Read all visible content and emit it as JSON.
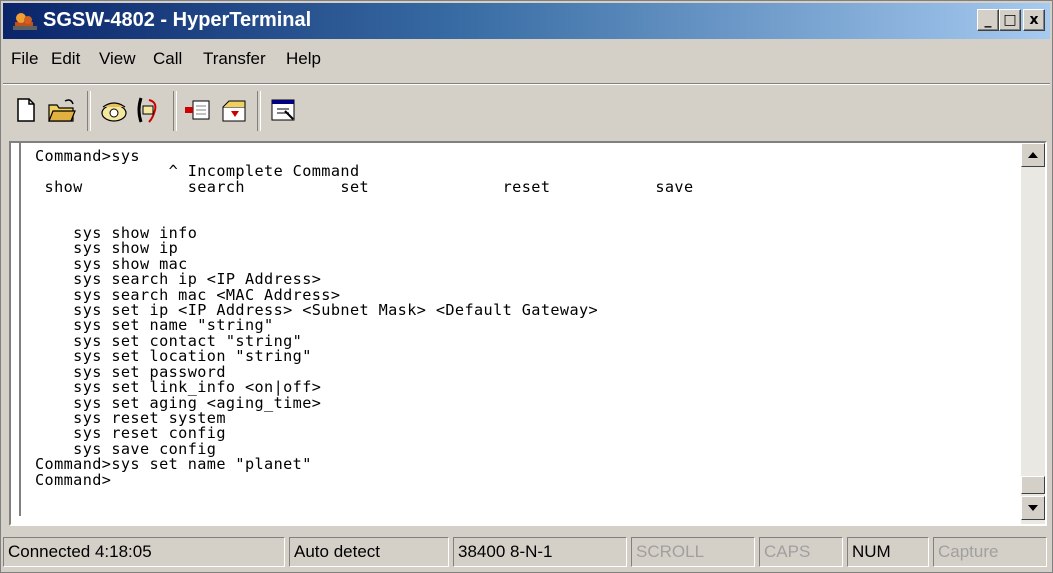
{
  "window": {
    "title": "SGSW-4802 - HyperTerminal",
    "minimize_label": "_",
    "maximize_label": "□",
    "close_label": "x"
  },
  "menu": {
    "file": "File",
    "edit": "Edit",
    "view": "View",
    "call": "Call",
    "transfer": "Transfer",
    "help": "Help"
  },
  "toolbar": {
    "icons": [
      "new-document-icon",
      "open-folder-icon",
      "connect-phone-icon",
      "disconnect-phone-icon",
      "send-file-icon",
      "receive-file-icon",
      "properties-icon"
    ]
  },
  "terminal": {
    "text": "Command>sys\n              ^ Incomplete Command\n show           search          set              reset           save\n\n\n    sys show info\n    sys show ip\n    sys show mac\n    sys search ip <IP Address>\n    sys search mac <MAC Address>\n    sys set ip <IP Address> <Subnet Mask> <Default Gateway>\n    sys set name \"string\"\n    sys set contact \"string\"\n    sys set location \"string\"\n    sys set password\n    sys set link_info <on|off>\n    sys set aging <aging_time>\n    sys reset system\n    sys reset config\n    sys save config\nCommand>sys set name \"planet\"\nCommand>"
  },
  "status": {
    "connected": "Connected 4:18:05",
    "detect": "Auto detect",
    "settings": "38400 8-N-1",
    "scroll": "SCROLL",
    "caps": "CAPS",
    "num": "NUM",
    "capture": "Capture"
  },
  "colors": {
    "titlebar_start": "#0a246a",
    "titlebar_end": "#a6caf0",
    "chrome": "#d4d0c8"
  }
}
